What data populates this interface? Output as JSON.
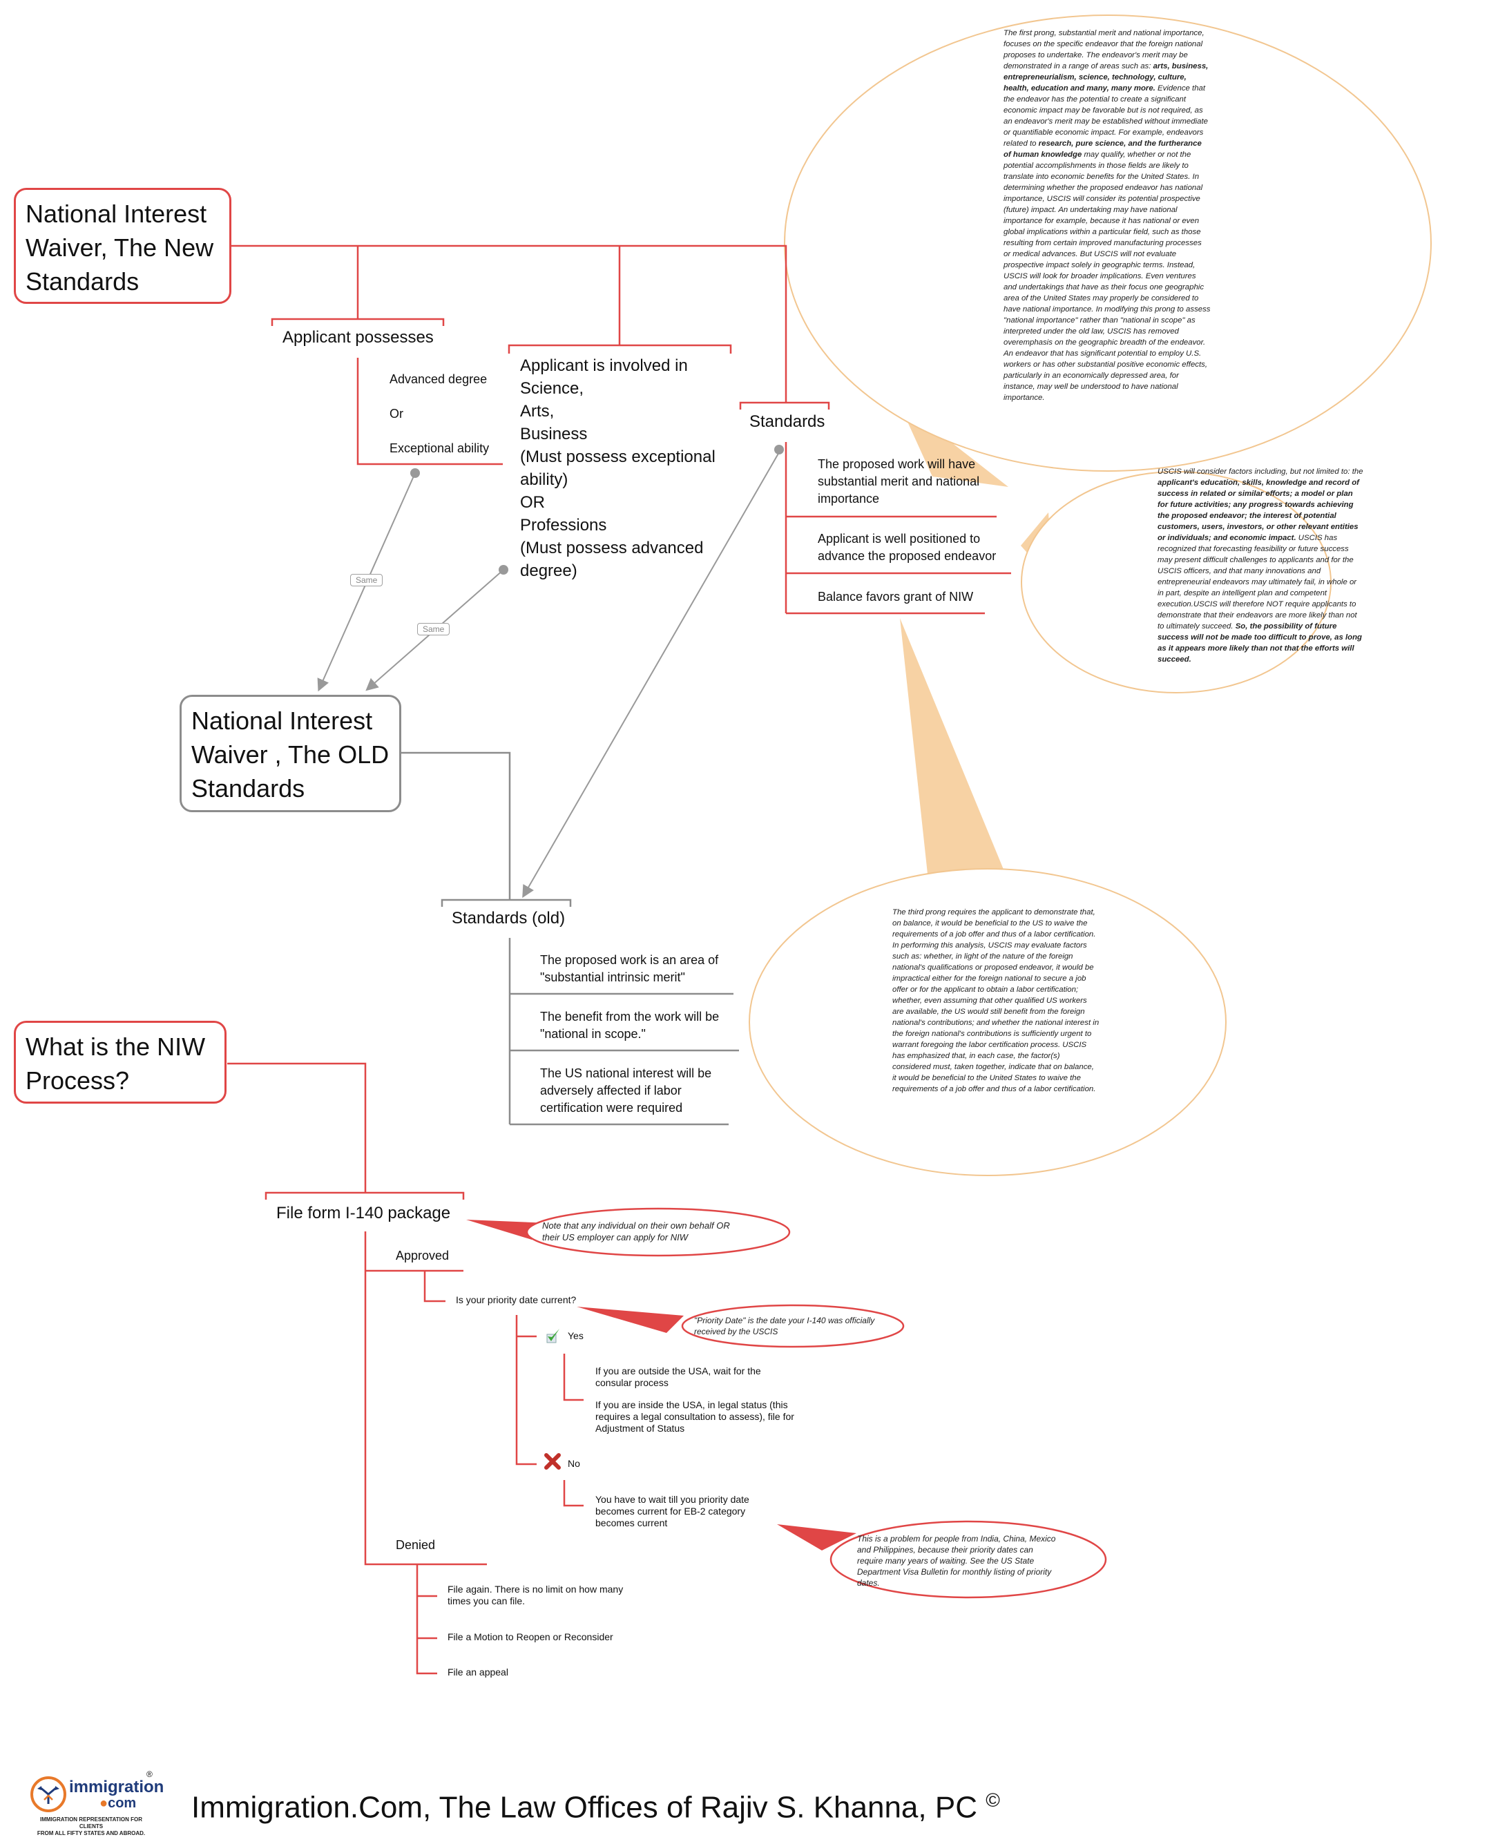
{
  "new_standards": {
    "title": "National Interest Waiver, The New Standards",
    "title_lines": [
      "National Interest",
      "Waiver, The New",
      "Standards"
    ],
    "applicant_possesses": {
      "label": "Applicant possesses",
      "items": [
        "Advanced degree",
        "Or",
        "Exceptional ability"
      ]
    },
    "applicant_involved": {
      "lines": [
        "Applicant is involved in",
        "Science,",
        "Arts,",
        "Business",
        "(Must possess exceptional",
        "ability)",
        "OR",
        "Professions",
        "(Must possess advanced",
        "degree)"
      ]
    },
    "standards": {
      "label": "Standards",
      "items": [
        "The proposed work will have substantial merit and national importance",
        "Applicant is well positioned to advance the proposed endeavor",
        "Balance favors grant of NIW"
      ]
    },
    "bubble_first_prong": [
      {
        "t": "The first prong, substantial merit and national importance, focuses on the specific endeavor that the foreign national proposes to undertake. The endeavor's merit may be demonstrated in a range of areas such as: ",
        "b": false
      },
      {
        "t": "arts, business, entrepreneurialism, science, technology, culture, health, education and many, many more.",
        "b": true
      },
      {
        "t": " Evidence that the endeavor has the potential to create a significant economic impact may be favorable but is not required, as an endeavor's merit may be established without immediate or quantifiable economic impact. For example, endeavors related to ",
        "b": false
      },
      {
        "t": "research, pure science, and the furtherance of human knowledge",
        "b": true
      },
      {
        "t": " may qualify, whether or not the potential accomplishments in those fields are likely to translate into economic benefits for the United States. In determining whether the proposed endeavor has national importance, USCIS will consider its potential prospective (future) impact. An undertaking may have national importance for example, because it has national or even global implications within a particular field, such as those resulting from certain improved manufacturing processes or medical advances. But USCIS will not evaluate prospective impact solely in geographic terms. Instead, USCIS will look for broader implications. Even ventures and undertakings that have as their focus one geographic area of the United States may properly be considered to have national importance. In modifying this prong to assess \"national importance\" rather than \"national in scope\" as interpreted under the old law, USCIS has removed overemphasis on the geographic breadth of the endeavor. An endeavor that has significant potential to employ U.S. workers or has other substantial positive economic effects, particularly in an economically depressed area, for instance, may well be understood to have national importance.",
        "b": false
      }
    ],
    "bubble_second_prong": [
      {
        "t": "USCIS will consider factors including, but not limited to: the ",
        "b": false
      },
      {
        "t": "applicant's education, skills, knowledge and record of success in related or similar efforts; a model or plan for future activities; any progress towards achieving the proposed endeavor; the interest of potential customers, users, investors, or other relevant entities or individuals; and economic impact.",
        "b": true
      },
      {
        "t": " USCIS has recognized that forecasting feasibility or future success may present difficult challenges to applicants and for the USCIS officers, and that many innovations and entrepreneurial endeavors may ultimately fail, in whole or in part, despite an intelligent plan and competent execution.USCIS will therefore NOT require applicants to demonstrate that their endeavors are more likely than not to ultimately succeed. ",
        "b": false
      },
      {
        "t": "So, the possibility of future success will not be made too difficult to prove, as long as it appears more likely than not that the efforts will succeed.",
        "b": true
      }
    ],
    "bubble_third_prong": "The third prong requires the applicant to demonstrate that, on balance, it would be beneficial to the US to waive the requirements of a job offer and thus of a labor certification. In performing this analysis, USCIS may evaluate factors such as: whether, in light of the nature of the foreign national's qualifications or proposed endeavor, it would be impractical either for the foreign national to secure a job offer or for the applicant to obtain a labor certification; whether, even assuming that other qualified US workers are available, the US would still benefit from the foreign national's contributions; and whether the national interest in the foreign national's contributions is sufficiently urgent to warrant foregoing the labor certification process. USCIS has emphasized that, in each case, the factor(s) considered must, taken together, indicate that on balance, it would be beneficial to the United States to waive the requirements of a job offer and thus of a labor certification."
  },
  "old_standards": {
    "title_lines": [
      "National Interest",
      "Waiver , The OLD",
      "Standards"
    ],
    "same_label_1": "Same",
    "same_label_2": "Same",
    "standards_label": "Standards (old)",
    "items": [
      "The proposed work is an area of \"substantial intrinsic merit\"",
      "The benefit from the work will be \"national in scope.\"",
      "The US national interest will be adversely affected if labor certification were required"
    ]
  },
  "process": {
    "title_lines": [
      "What is the NIW",
      "Process?"
    ],
    "file_form": "File form I-140 package",
    "file_note": "Note that any individual on their own behalf OR their US employer  can apply for NIW",
    "approved": "Approved",
    "priority_question": "Is your priority date current?",
    "priority_note": "\"Priority Date\" is the date your I-140 was officially received by the USCIS",
    "yes_label": "Yes",
    "yes_items": [
      "If you are outside the USA, wait for the consular process",
      "If you are inside the USA, in legal status (this requires a legal consultation to assess), file for Adjustment of Status"
    ],
    "no_label": "No",
    "no_item": "You have to wait till you priority date becomes current for EB-2 category becomes current",
    "no_note": "This is a problem for people from India, China, Mexico and Philippines, because their priority dates can require many years of waiting.  See the US State Department Visa Bulletin for monthly listing of priority dates.",
    "denied": "Denied",
    "denied_items": [
      "File again. There is no limit on how many times you can file.",
      "File a Motion to Reopen or Reconsider",
      "File an appeal"
    ]
  },
  "footer": {
    "logo_word": "immigration",
    "logo_com": "com",
    "logo_reg": "®",
    "logo_tagline_1": "IMMIGRATION REPRESENTATION FOR CLIENTS",
    "logo_tagline_2": "FROM ALL FIFTY STATES AND ABROAD.",
    "title": "Immigration.Com, The Law Offices of Rajiv S. Khanna, PC",
    "copyright": "©"
  },
  "colors": {
    "branch_red": "#e04646",
    "branch_gray": "#8c8c8c",
    "bubble_orange": "#f7d2a4",
    "connector_gray": "#999999"
  }
}
